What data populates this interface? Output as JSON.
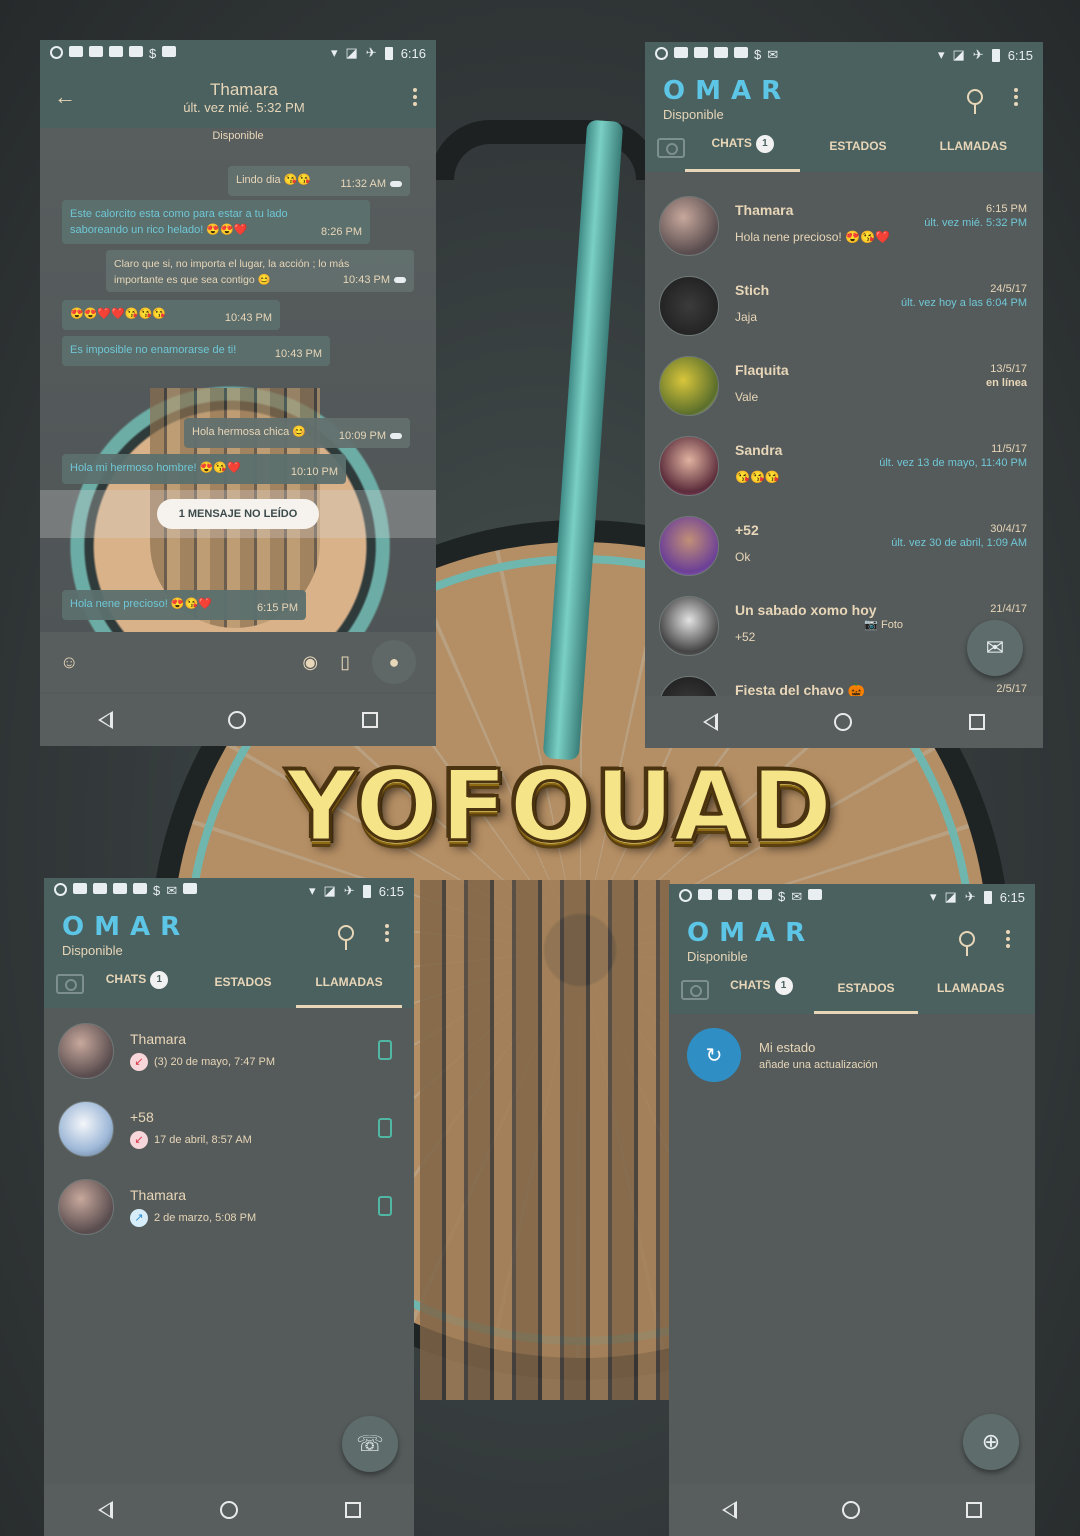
{
  "banner": {
    "text": "YOFOUAD"
  },
  "chat_screen": {
    "status_time": "6:16",
    "contact_name": "Thamara",
    "last_seen": "últ. vez mié. 5:32 PM",
    "presence": "Disponible",
    "messages": [
      {
        "text": "Lindo dia 😘😘",
        "time": "11:32 AM",
        "dir": "out"
      },
      {
        "text": "Este calorcito esta como para estar a tu lado saboreando un rico helado! 😍😍❤️",
        "time": "8:26 PM",
        "dir": "in"
      },
      {
        "text": "Claro que si, no importa el lugar, la acción ; lo más importante es que sea contigo 😊",
        "time": "10:43 PM",
        "dir": "out"
      },
      {
        "text": "😍😍❤️❤️😘😘😘",
        "time": "10:43 PM",
        "dir": "in"
      },
      {
        "text": "Es imposible no enamorarse de ti!",
        "time": "10:43 PM",
        "dir": "in"
      },
      {
        "text": "Hola hermosa chica 😊",
        "time": "10:09 PM",
        "dir": "out"
      },
      {
        "text": "Hola mi hermoso hombre! 😍😘❤️",
        "time": "10:10 PM",
        "dir": "in"
      },
      {
        "text": "Hola nene precioso! 😍😘❤️",
        "time": "6:15 PM",
        "dir": "in"
      }
    ],
    "unread_label": "1 MENSAJE NO LEÍDO"
  },
  "app": {
    "title": "OMAR",
    "subtitle": "Disponible",
    "tabs": {
      "chats": "CHATS",
      "chats_badge": "1",
      "status": "ESTADOS",
      "calls": "LLAMADAS"
    }
  },
  "chats_screen": {
    "status_time": "6:15",
    "chats": [
      {
        "name": "Thamara",
        "message": "Hola nene precioso! 😍😘❤️",
        "date": "6:15 PM",
        "seen": "últ. vez mié. 5:32 PM"
      },
      {
        "name": "Stich",
        "message": "Jaja",
        "date": "24/5/17",
        "seen": "últ. vez hoy a las 6:04 PM"
      },
      {
        "name": "Flaquita",
        "message": "Vale",
        "date": "13/5/17",
        "seen": "en línea"
      },
      {
        "name": "Sandra",
        "message": "😘😘😘",
        "date": "11/5/17",
        "seen": "últ. vez 13 de mayo, 11:40 PM"
      },
      {
        "name": "+52",
        "message": "Ok",
        "date": "30/4/17",
        "seen": "últ. vez 30 de abril, 1:09 AM"
      },
      {
        "name": "Un sabado xomo hoy",
        "message": "+52",
        "date": "21/4/17",
        "seen": "📷 Foto"
      },
      {
        "name": "Fiesta del chavo 🎃",
        "message": "",
        "date": "2/5/17",
        "seen": ""
      }
    ]
  },
  "calls_screen": {
    "status_time": "6:15",
    "calls": [
      {
        "name": "Thamara",
        "meta": "(3)  20 de mayo, 7:47 PM",
        "dir": "missed"
      },
      {
        "name": "+58",
        "meta": "17 de abril, 8:57 AM",
        "dir": "missed"
      },
      {
        "name": "Thamara",
        "meta": "2 de marzo, 5:08 PM",
        "dir": "out"
      }
    ]
  },
  "status_screen": {
    "status_time": "6:15",
    "my_status": "Mi estado",
    "my_status_hint": "añade una actualización"
  },
  "colors": {
    "header": "#4a6160",
    "body": "#555b5b",
    "accent_text": "#e8d6b8",
    "title_blue": "#5dc6e6",
    "banner_gold": "#e9c33a"
  }
}
